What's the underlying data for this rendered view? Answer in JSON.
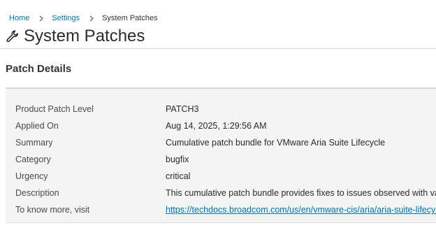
{
  "breadcrumb": {
    "items": [
      {
        "label": "Home"
      },
      {
        "label": "Settings"
      }
    ],
    "current": "System Patches"
  },
  "header": {
    "title": "System Patches",
    "icon": "wrench-icon"
  },
  "section": {
    "title": "Patch Details"
  },
  "details": [
    {
      "label": "Product Patch Level",
      "value": "PATCH3"
    },
    {
      "label": "Applied On",
      "value": "Aug 14, 2025, 1:29:56 AM"
    },
    {
      "label": "Summary",
      "value": "Cumulative patch bundle for VMware Aria Suite Lifecycle"
    },
    {
      "label": "Category",
      "value": "bugfix"
    },
    {
      "label": "Urgency",
      "value": "critical"
    },
    {
      "label": "Description",
      "value": "This cumulative patch bundle provides fixes to issues observed with vario"
    },
    {
      "label": "To know more, visit",
      "value": "https://techdocs.broadcom.com/us/en/vmware-cis/aria/aria-suite-lifecycle"
    }
  ],
  "colors": {
    "link": "#0072a3",
    "card_bg": "#f4f4f4",
    "text": "#333333"
  }
}
